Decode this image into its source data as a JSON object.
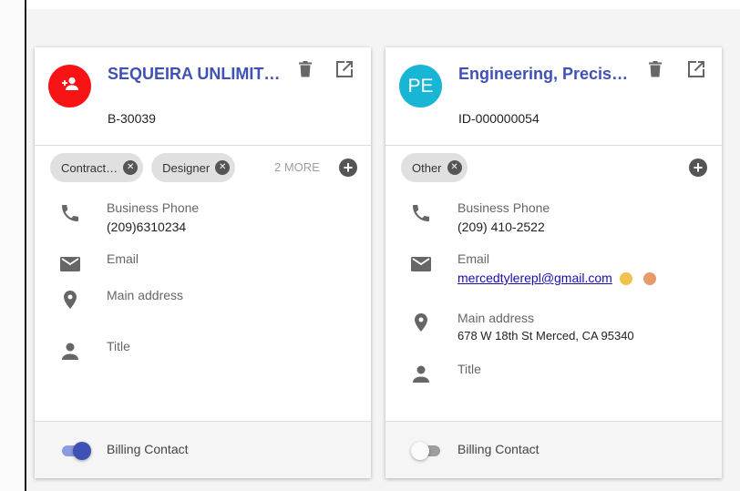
{
  "cards": [
    {
      "title": "SEQUEIRA UNLIMITED",
      "id": "B-30039",
      "avatar": {
        "type": "icon",
        "icon": "add-person-icon",
        "color": "#f81414"
      },
      "chips": [
        "Contract…",
        "Designer"
      ],
      "more_label": "2 MORE",
      "fields": {
        "phone_label": "Business Phone",
        "phone_value": "(209)6310234",
        "email_label": "Email",
        "address_label": "Main address",
        "title_label": "Title"
      },
      "billing_label": "Billing Contact",
      "billing_on": true
    },
    {
      "title": "Engineering, Precision",
      "id": "ID-000000054",
      "avatar": {
        "type": "initials",
        "text": "PE",
        "color": "#18b5d4"
      },
      "chips": [
        "Other"
      ],
      "fields": {
        "phone_label": "Business Phone",
        "phone_value": "(209) 410-2522",
        "email_label": "Email",
        "email_value": "mercedtylerepl@gmail.com",
        "address_label": "Main address",
        "address_value": "678 W 18th St Merced, CA 95340",
        "title_label": "Title"
      },
      "billing_label": "Billing Contact",
      "billing_on": false
    }
  ],
  "colors": {
    "accent": "#3f51b5",
    "icon": "#666666"
  }
}
